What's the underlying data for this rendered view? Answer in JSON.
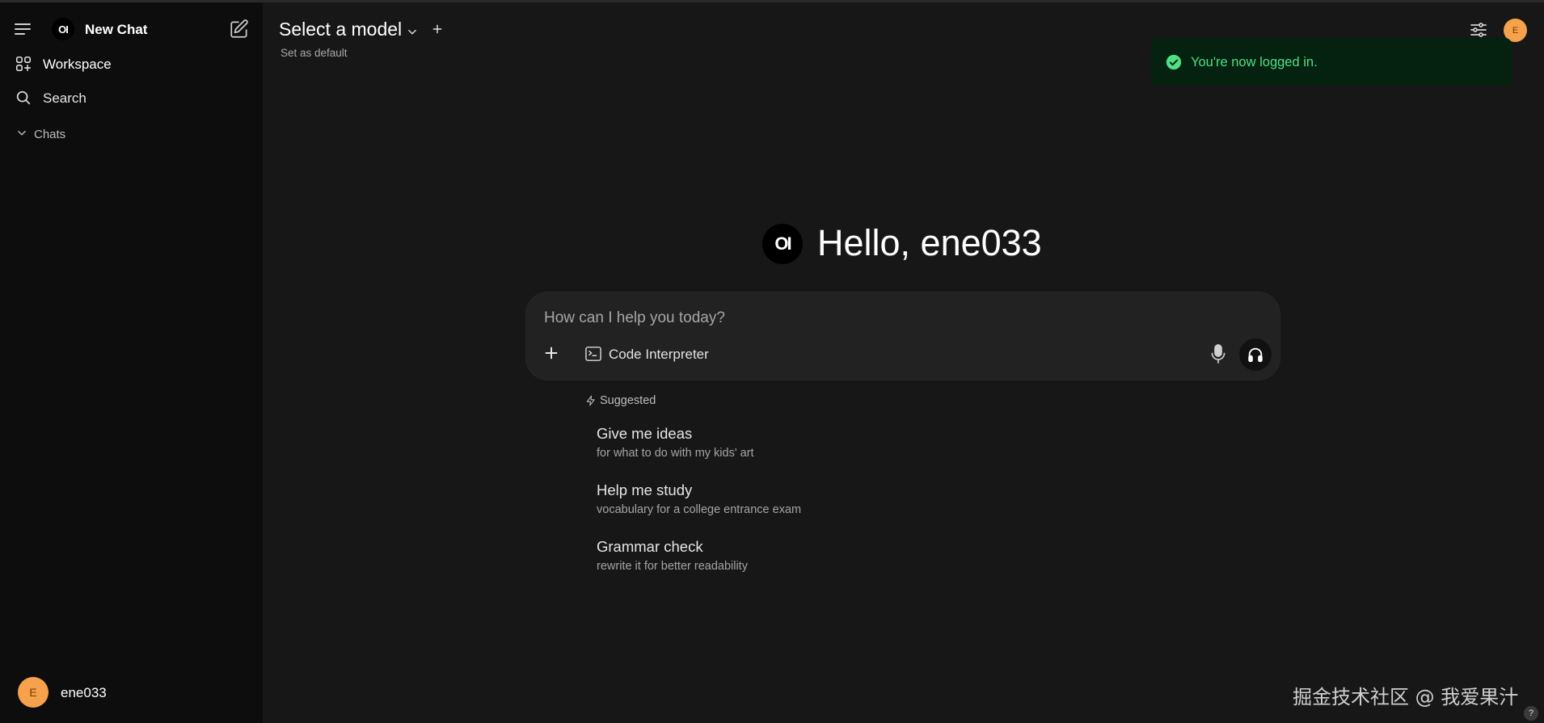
{
  "sidebar": {
    "logo_text": "OI",
    "new_chat_label": "New Chat",
    "workspace_label": "Workspace",
    "search_label": "Search",
    "chats_label": "Chats",
    "user": {
      "avatar_initial": "E",
      "name": "ene033"
    }
  },
  "header": {
    "model_title": "Select a model",
    "set_default_label": "Set as default",
    "top_avatar_initial": "E"
  },
  "toast": {
    "message": "You're now logged in."
  },
  "hero": {
    "logo_text": "OI",
    "greeting": "Hello, ene033"
  },
  "chat_input": {
    "placeholder": "How can I help you today?",
    "code_interpreter_label": "Code Interpreter"
  },
  "suggested": {
    "heading": "Suggested",
    "items": [
      {
        "title": "Give me ideas",
        "subtitle": "for what to do with my kids' art"
      },
      {
        "title": "Help me study",
        "subtitle": "vocabulary for a college entrance exam"
      },
      {
        "title": "Grammar check",
        "subtitle": "rewrite it for better readability"
      }
    ]
  },
  "watermark": "掘金技术社区 @ 我爱果汁",
  "help_label": "?",
  "colors": {
    "sidebar_bg": "#0d0d0d",
    "main_bg": "#171717",
    "avatar": "#f6a14b",
    "toast_bg": "#05210f",
    "toast_text": "#4ee085"
  },
  "icons": [
    "menu-icon",
    "edit-icon",
    "workspace-icon",
    "search-icon",
    "chevron-down-icon",
    "plus-icon",
    "controls-icon",
    "check-circle-icon",
    "terminal-icon",
    "mic-icon",
    "headphones-icon",
    "bolt-icon"
  ]
}
